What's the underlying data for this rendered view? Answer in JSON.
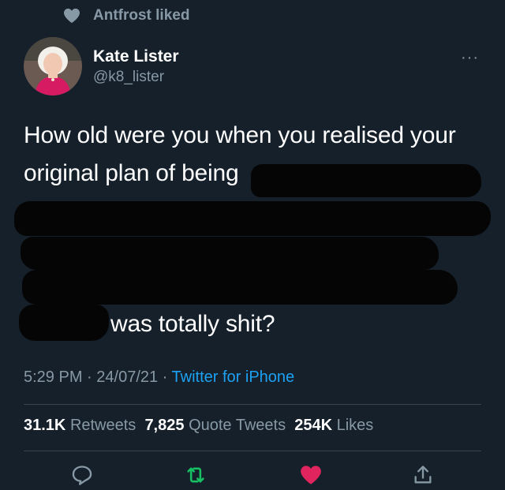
{
  "social_context": {
    "icon": "heart-icon",
    "text": "Antfrost liked"
  },
  "author": {
    "name": "Kate Lister",
    "handle": "@k8_lister",
    "avatar": "avatar-photo"
  },
  "menu": {
    "icon": "more-options-icon",
    "label": "···"
  },
  "tweet": {
    "line1": "How old were you when you realised your",
    "line2": "original plan of being",
    "last_line": "was totally shit?"
  },
  "meta": {
    "time": "5:29 PM",
    "sep1": " · ",
    "date": "24/07/21",
    "sep2": " · ",
    "source": "Twitter for iPhone"
  },
  "stats": {
    "retweets_count": "31.1K",
    "retweets_label": "Retweets",
    "quotes_count": "7,825",
    "quotes_label": "Quote Tweets",
    "likes_count": "254K",
    "likes_label": "Likes"
  },
  "actions": [
    {
      "name": "reply",
      "icon": "reply-icon",
      "color": "#8899a6"
    },
    {
      "name": "retweet",
      "icon": "retweet-icon",
      "color": "#17bf63"
    },
    {
      "name": "like",
      "icon": "heart-filled-icon",
      "color": "#e0245e"
    },
    {
      "name": "share",
      "icon": "share-icon",
      "color": "#8899a6"
    }
  ],
  "colors": {
    "background": "#15202b",
    "secondary_text": "#8899a6",
    "link": "#1da1f2",
    "divider": "#38444d",
    "redaction": "#050505"
  }
}
